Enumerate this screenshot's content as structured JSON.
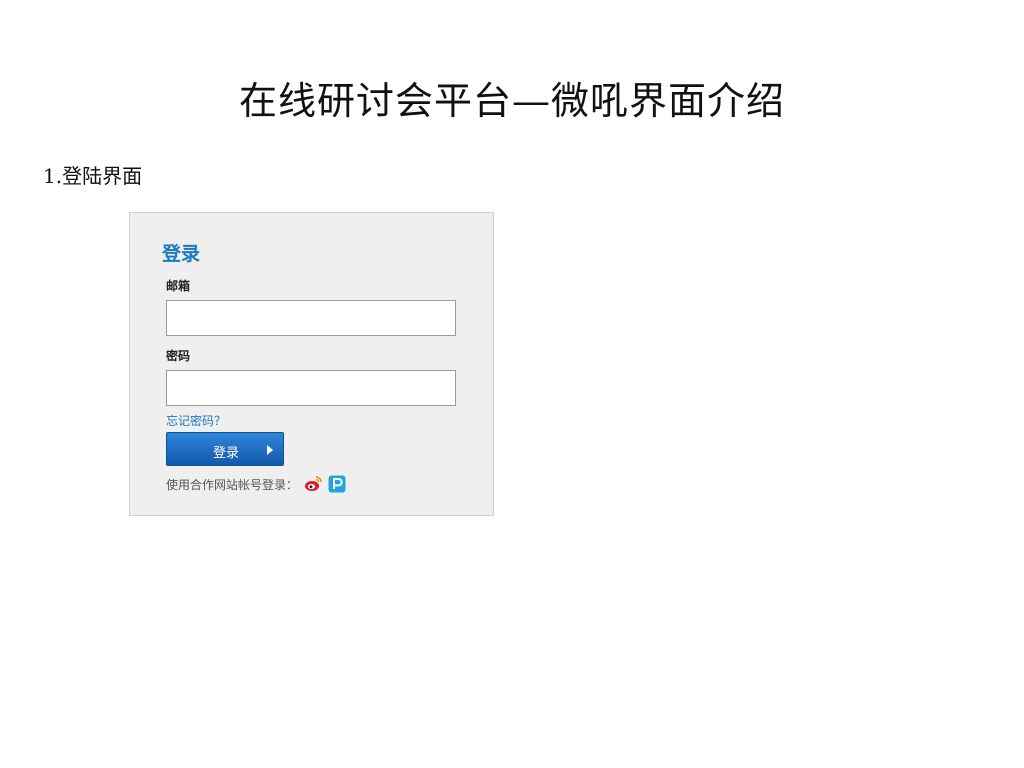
{
  "slide": {
    "title": "在线研讨会平台—微吼界面介绍",
    "section": "1.登陆界面"
  },
  "login": {
    "title": "登录",
    "email_label": "邮箱",
    "email_value": "",
    "password_label": "密码",
    "password_value": "",
    "forgot_link": "忘记密码？",
    "submit_label": "登录",
    "partner_prompt": "使用合作网站帐号登录：",
    "partner_icons": [
      "weibo-icon",
      "p-icon"
    ]
  },
  "colors": {
    "accent": "#1a78c2",
    "button_top": "#2f86d9",
    "button_bottom": "#1259ab",
    "weibo_red": "#e6162d",
    "p_cyan": "#21a5df"
  }
}
